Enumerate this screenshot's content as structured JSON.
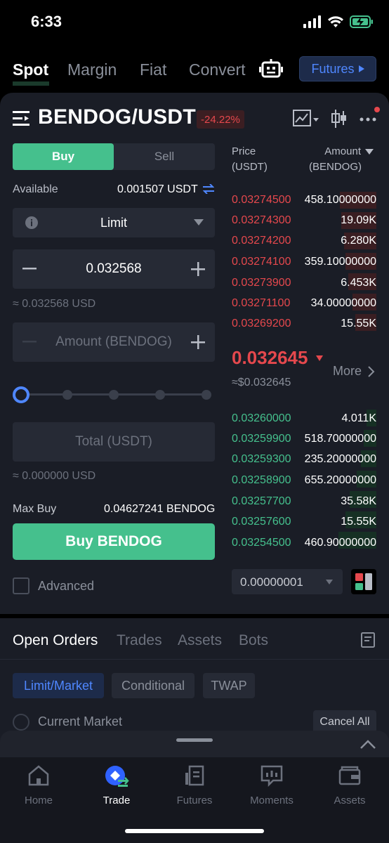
{
  "status_bar": {
    "time": "6:33"
  },
  "top_tabs": {
    "items": [
      "Spot",
      "Margin",
      "Fiat",
      "Convert"
    ],
    "active": "Spot",
    "futures_label": "Futures"
  },
  "pair": {
    "name": "BENDOG/USDT",
    "change_pct": "-24.22%"
  },
  "trade_form": {
    "buy_label": "Buy",
    "sell_label": "Sell",
    "available_label": "Available",
    "available_value": "0.001507 USDT",
    "order_type": "Limit",
    "price_value": "0.032568",
    "price_usd": "≈ 0.032568 USD",
    "amount_placeholder": "Amount (BENDOG)",
    "slider_level_pct": 0,
    "total_placeholder": "Total (USDT)",
    "total_usd": "≈ 0.000000 USD",
    "max_buy_label": "Max Buy",
    "max_buy_value": "0.04627241 BENDOG",
    "buy_button": "Buy BENDOG",
    "advanced_label": "Advanced"
  },
  "order_book": {
    "price_header": "Price",
    "price_unit": "(USDT)",
    "amount_header": "Amount",
    "amount_unit": "(BENDOG)",
    "asks": [
      {
        "price": "0.03274500",
        "amount": "458.10000000"
      },
      {
        "price": "0.03274300",
        "amount": "19.09K"
      },
      {
        "price": "0.03274200",
        "amount": "6.280K"
      },
      {
        "price": "0.03274100",
        "amount": "359.10000000"
      },
      {
        "price": "0.03273900",
        "amount": "6.453K"
      },
      {
        "price": "0.03271100",
        "amount": "34.00000000"
      },
      {
        "price": "0.03269200",
        "amount": "15.55K"
      }
    ],
    "last_price": "0.032645",
    "last_price_usd": "≈$0.032645",
    "more_label": "More",
    "bids": [
      {
        "price": "0.03260000",
        "amount": "4.011K"
      },
      {
        "price": "0.03259900",
        "amount": "518.70000000"
      },
      {
        "price": "0.03259300",
        "amount": "235.20000000"
      },
      {
        "price": "0.03258900",
        "amount": "655.20000000"
      },
      {
        "price": "0.03257700",
        "amount": "35.58K"
      },
      {
        "price": "0.03257600",
        "amount": "15.55K"
      },
      {
        "price": "0.03254500",
        "amount": "460.90000000"
      }
    ],
    "precision": "0.00000001"
  },
  "orders": {
    "tabs": [
      "Open Orders",
      "Trades",
      "Assets",
      "Bots"
    ],
    "active_tab": "Open Orders",
    "filters": [
      "Limit/Market",
      "Conditional",
      "TWAP"
    ],
    "active_filter": "Limit/Market",
    "current_market_label": "Current Market",
    "cancel_all_label": "Cancel All"
  },
  "bottom_nav": {
    "items": [
      "Home",
      "Trade",
      "Futures",
      "Moments",
      "Assets"
    ],
    "active": "Trade"
  },
  "colors": {
    "buy_green": "#45c08d",
    "sell_red": "#e5484d",
    "accent_blue": "#4f87ff",
    "card_bg": "#1a1d26"
  },
  "icons": {
    "menu": "hamburger-menu-icon",
    "chart": "line-chart-icon",
    "candles": "candlestick-icon",
    "more": "more-dots-icon",
    "robot": "robot-icon",
    "info": "info-icon",
    "swap": "swap-arrows-icon"
  }
}
